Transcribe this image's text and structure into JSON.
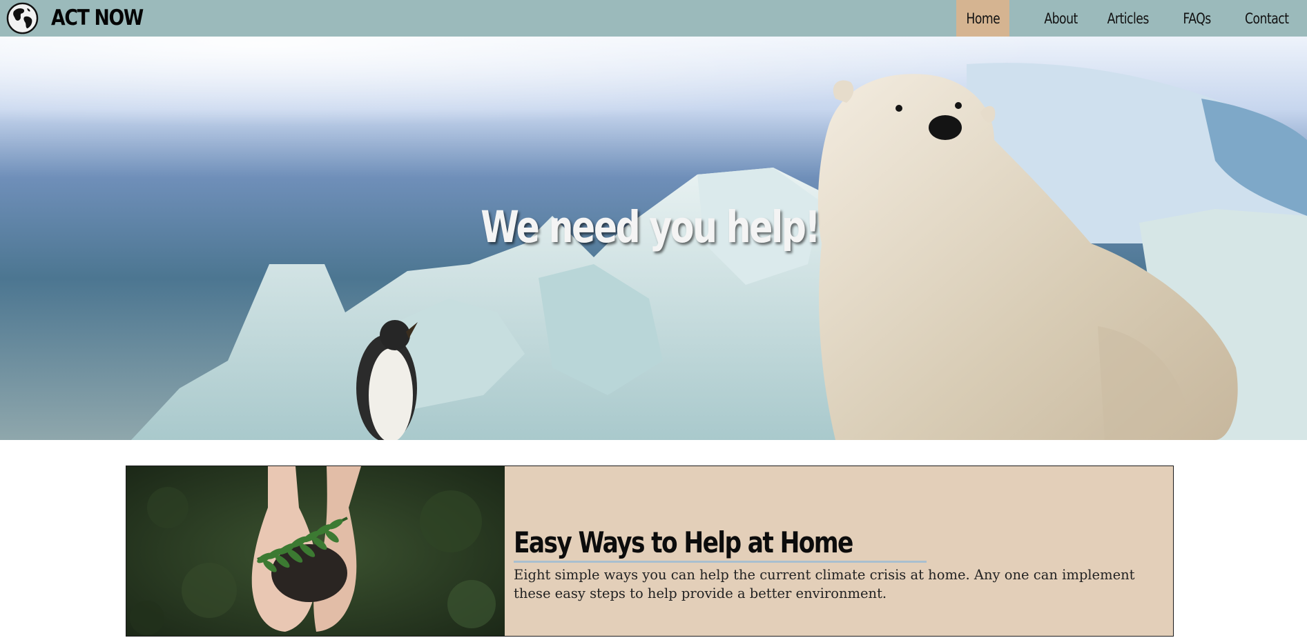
{
  "brand": {
    "name": "ACT NOW",
    "logo_icon": "globe-icon"
  },
  "nav": {
    "items": [
      {
        "label": "Home",
        "active": true
      },
      {
        "label": "About",
        "active": false
      },
      {
        "label": "Articles",
        "active": false
      },
      {
        "label": "FAQs",
        "active": false
      },
      {
        "label": "Contact",
        "active": false
      }
    ]
  },
  "hero": {
    "title": "We need you help!",
    "image": "polar-bear-and-penguin-on-ice-image"
  },
  "card": {
    "image": "hands-holding-soil-and-fern-image",
    "title": "Easy Ways to Help at Home",
    "text": "Eight simple ways you can help the current climate crisis at home. Any one can implement these easy steps to help provide a better environment."
  },
  "colors": {
    "navbar": "#9bbabb",
    "nav_active": "#d5b491",
    "card_bg": "#e3cfb9"
  }
}
